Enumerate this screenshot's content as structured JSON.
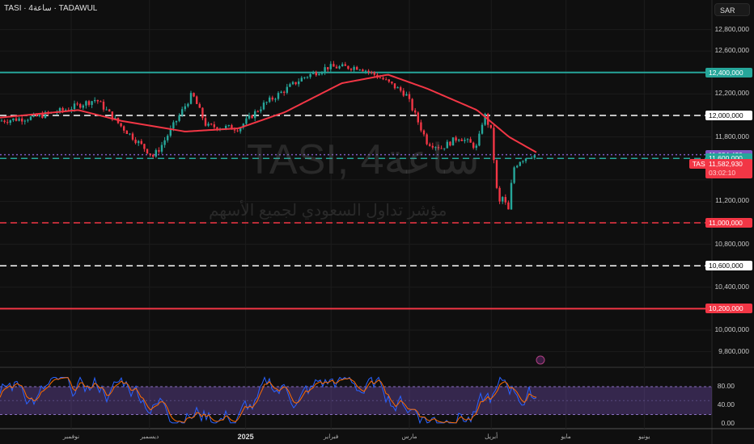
{
  "header": {
    "symbol": "TASI · 4ساعة · TADAWUL",
    "currency": "SAR"
  },
  "watermark": {
    "title": "TASI, 4ساعة",
    "subtitle": "مؤشر تداول السعودي لجميع الأسهم"
  },
  "chart_data": [
    {
      "type": "candlestick",
      "title": "TASI, 4H",
      "y_ticks": [
        "12,800,000",
        "12,600,000",
        "12,200,000",
        "11,800,000",
        "11,200,000",
        "10,800,000",
        "10,400,000",
        "10,000,000",
        "9,800,000"
      ],
      "ylim": [
        9700000,
        13000000
      ],
      "x_labels": [
        {
          "label": "نوفمبر",
          "pos": 0.1
        },
        {
          "label": "ديسمبر",
          "pos": 0.21
        },
        {
          "label": "2025",
          "pos": 0.345
        },
        {
          "label": "فبراير",
          "pos": 0.465
        },
        {
          "label": "مارس",
          "pos": 0.575
        },
        {
          "label": "أبريل",
          "pos": 0.69
        },
        {
          "label": "مايو",
          "pos": 0.795
        },
        {
          "label": "يونيو",
          "pos": 0.905
        }
      ],
      "price_path": [
        [
          0,
          11950
        ],
        [
          0.045,
          11980
        ],
        [
          0.09,
          12050
        ],
        [
          0.135,
          12150
        ],
        [
          0.17,
          11900
        ],
        [
          0.215,
          11620
        ],
        [
          0.225,
          11700
        ],
        [
          0.27,
          12200
        ],
        [
          0.29,
          11900
        ],
        [
          0.335,
          11880
        ],
        [
          0.37,
          12100
        ],
        [
          0.425,
          12350
        ],
        [
          0.46,
          12450
        ],
        [
          0.505,
          12450
        ],
        [
          0.535,
          12350
        ],
        [
          0.57,
          12200
        ],
        [
          0.6,
          11750
        ],
        [
          0.62,
          11700
        ],
        [
          0.645,
          11800
        ],
        [
          0.67,
          11700
        ],
        [
          0.68,
          12020
        ],
        [
          0.69,
          11850
        ],
        [
          0.7,
          11150
        ],
        [
          0.705,
          11250
        ],
        [
          0.715,
          11100
        ],
        [
          0.72,
          11500
        ],
        [
          0.73,
          11580
        ],
        [
          0.745,
          11630
        ],
        [
          0.755,
          11630
        ]
      ],
      "ma_path": [
        [
          0,
          11980
        ],
        [
          0.11,
          12050
        ],
        [
          0.17,
          11950
        ],
        [
          0.26,
          11850
        ],
        [
          0.335,
          11880
        ],
        [
          0.4,
          12030
        ],
        [
          0.48,
          12300
        ],
        [
          0.545,
          12380
        ],
        [
          0.6,
          12250
        ],
        [
          0.67,
          12050
        ],
        [
          0.715,
          11800
        ],
        [
          0.755,
          11650
        ]
      ],
      "price_scale_thousands": true,
      "levels": [
        {
          "value": "12,400,000",
          "price": 12400000,
          "color": "#26a69a",
          "style": "solid"
        },
        {
          "value": "12,000,000",
          "price": 12000000,
          "color": "#ffffff",
          "style": "dashed"
        },
        {
          "value": "11,634,420",
          "price": 11634420,
          "color": "#7e57c2",
          "style": "dotted"
        },
        {
          "value": "11,600,000",
          "price": 11600000,
          "color": "#26a69a",
          "style": "dashed"
        },
        {
          "value": "11,000,000",
          "price": 11000000,
          "color": "#f23645",
          "style": "dashed"
        },
        {
          "value": "10,600,000",
          "price": 10600000,
          "color": "#ffffff",
          "style": "dashed"
        },
        {
          "value": "10,200,000",
          "price": 10200000,
          "color": "#f23645",
          "style": "solid"
        }
      ],
      "last": {
        "tag": "TASI",
        "price": "11,582,930",
        "countdown": "03:02:10",
        "value": 11582930
      }
    },
    {
      "type": "line",
      "title": "Stochastic RSI",
      "y_ticks": [
        "80.00",
        "40.00",
        "0.00"
      ],
      "ylim": [
        0,
        100
      ],
      "band": [
        20,
        80
      ]
    }
  ]
}
